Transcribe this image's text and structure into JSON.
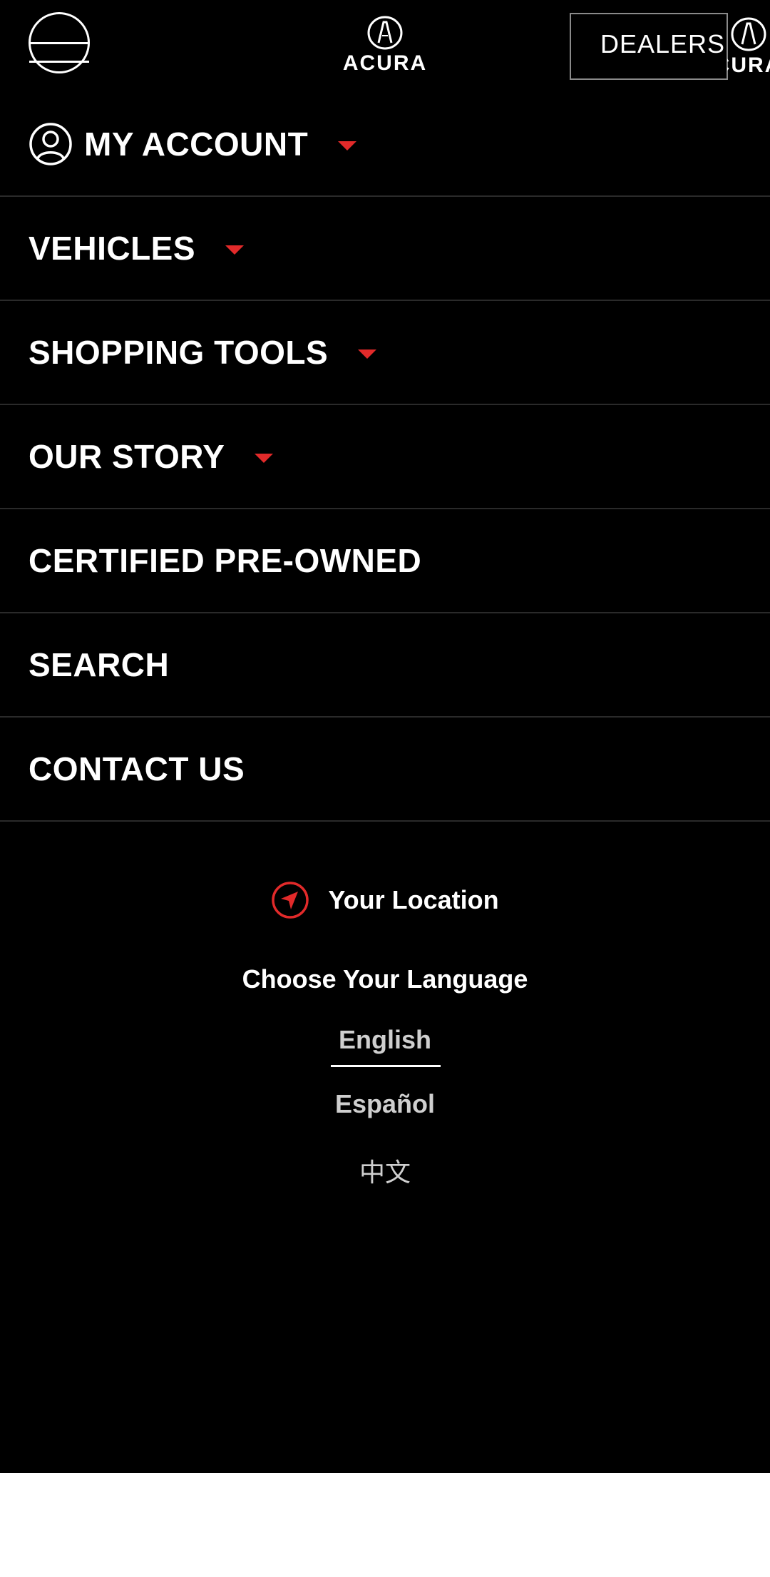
{
  "header": {
    "logo_text": "ACURA",
    "dealers_label": "DEALERS",
    "mini_logo_text": "ACURA"
  },
  "menu": {
    "account": "MY ACCOUNT",
    "vehicles": "VEHICLES",
    "shopping_tools": "SHOPPING TOOLS",
    "our_story": "OUR STORY",
    "certified": "CERTIFIED PRE-OWNED",
    "search": "SEARCH",
    "contact": "CONTACT US"
  },
  "footer": {
    "location": "Your Location",
    "language_title": "Choose Your Language",
    "languages": [
      "English",
      "Español",
      "中文"
    ],
    "selected_language": "English"
  },
  "colors": {
    "background": "#000000",
    "accent": "#e22a2a",
    "text": "#ffffff",
    "divider": "#2a2a2a"
  }
}
